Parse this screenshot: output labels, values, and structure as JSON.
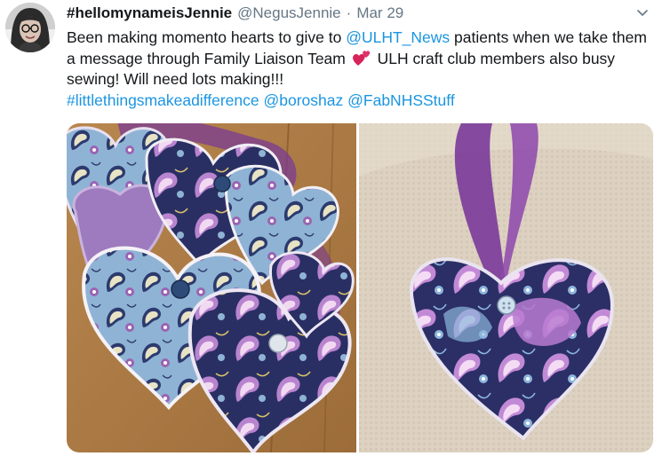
{
  "tweet": {
    "display_name": "#hellomynameisJennie",
    "handle": "@NegusJennie",
    "separator": "·",
    "date": "Mar 29",
    "text": {
      "t1": "Been making momento hearts to give to ",
      "m1": "@ULHT_News",
      "t2": " patients when we take them a message through Family Liaison Team ",
      "t3": " ULH craft club members also busy sewing! Will need lots making!!!",
      "h1": "#littlethingsmakeadifference",
      "m2": "@boroshaz",
      "m3": "@FabNHSStuff"
    },
    "link_color": "#1b95e0"
  },
  "icons": {
    "avatar": "profile-photo",
    "menu": "chevron-down-icon",
    "emoji": "two-hearts-emoji"
  }
}
